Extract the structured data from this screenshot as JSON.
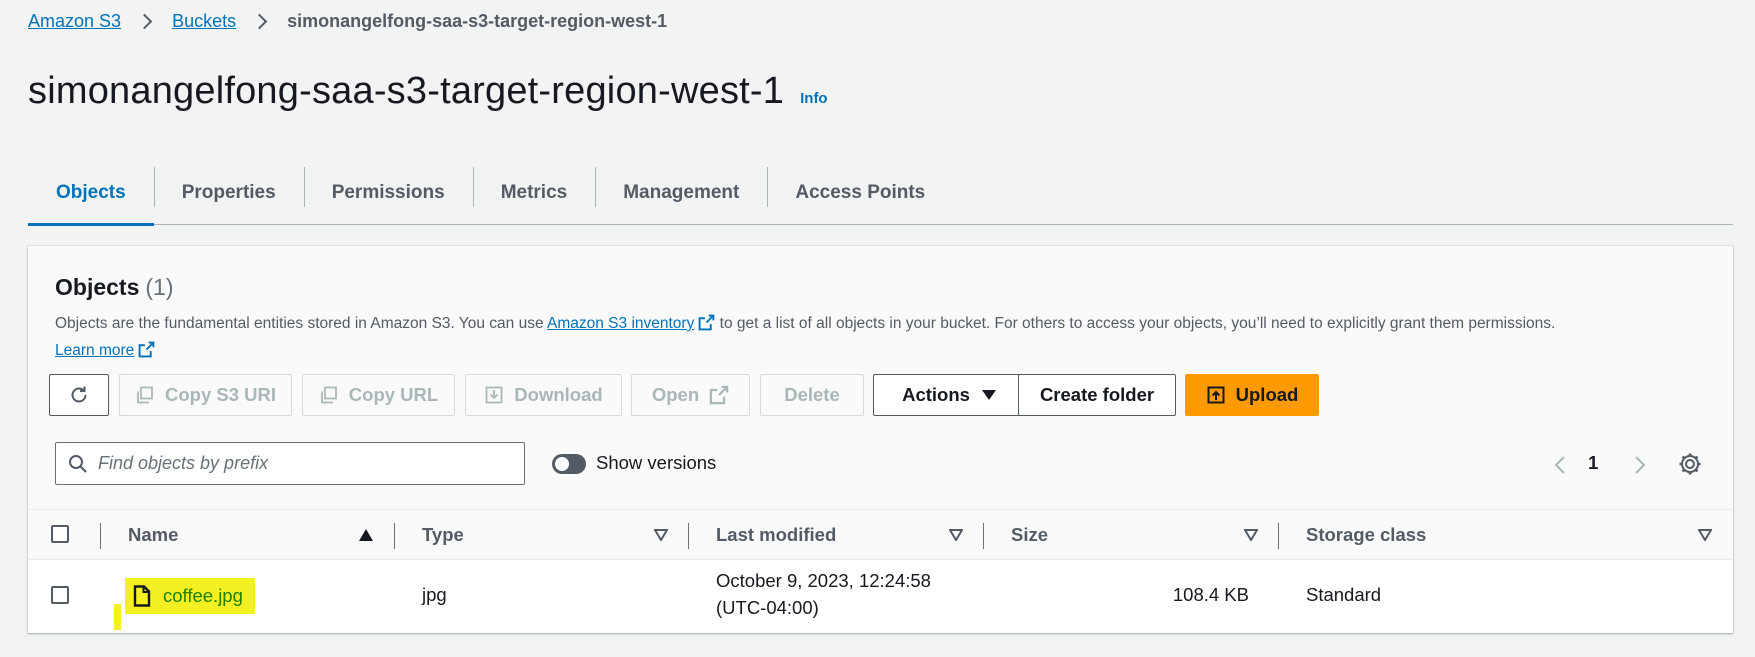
{
  "breadcrumb": {
    "items": [
      "Amazon S3",
      "Buckets"
    ],
    "current": "simonangelfong-saa-s3-target-region-west-1"
  },
  "page": {
    "title": "simonangelfong-saa-s3-target-region-west-1",
    "info_label": "Info"
  },
  "tabs": [
    "Objects",
    "Properties",
    "Permissions",
    "Metrics",
    "Management",
    "Access Points"
  ],
  "objects_panel": {
    "title": "Objects",
    "count": "(1)",
    "description_before": "Objects are the fundamental entities stored in Amazon S3. You can use ",
    "inventory_link": "Amazon S3 inventory",
    "description_after": " to get a list of all objects in your bucket. For others to access your objects, you’ll need to explicitly grant them permissions.",
    "learn_more": "Learn more"
  },
  "toolbar": {
    "copy_s3_uri": "Copy S3 URI",
    "copy_url": "Copy URL",
    "download": "Download",
    "open": "Open",
    "delete": "Delete",
    "actions": "Actions",
    "create_folder": "Create folder",
    "upload": "Upload"
  },
  "search": {
    "placeholder": "Find objects by prefix",
    "value": ""
  },
  "show_versions": {
    "label": "Show versions",
    "enabled": false
  },
  "pagination": {
    "current_page": "1"
  },
  "table": {
    "columns": [
      "Name",
      "Type",
      "Last modified",
      "Size",
      "Storage class"
    ],
    "rows": [
      {
        "name": "coffee.jpg",
        "type": "jpg",
        "last_modified_line1": "October 9, 2023, 12:24:58",
        "last_modified_line2": "(UTC-04:00)",
        "size": "108.4 KB",
        "storage_class": "Standard"
      }
    ]
  },
  "colors": {
    "link_blue": "#0073bb",
    "upload_orange": "#ff9900",
    "highlight_yellow": "#f5f021",
    "object_link_green": "#1d8102"
  }
}
